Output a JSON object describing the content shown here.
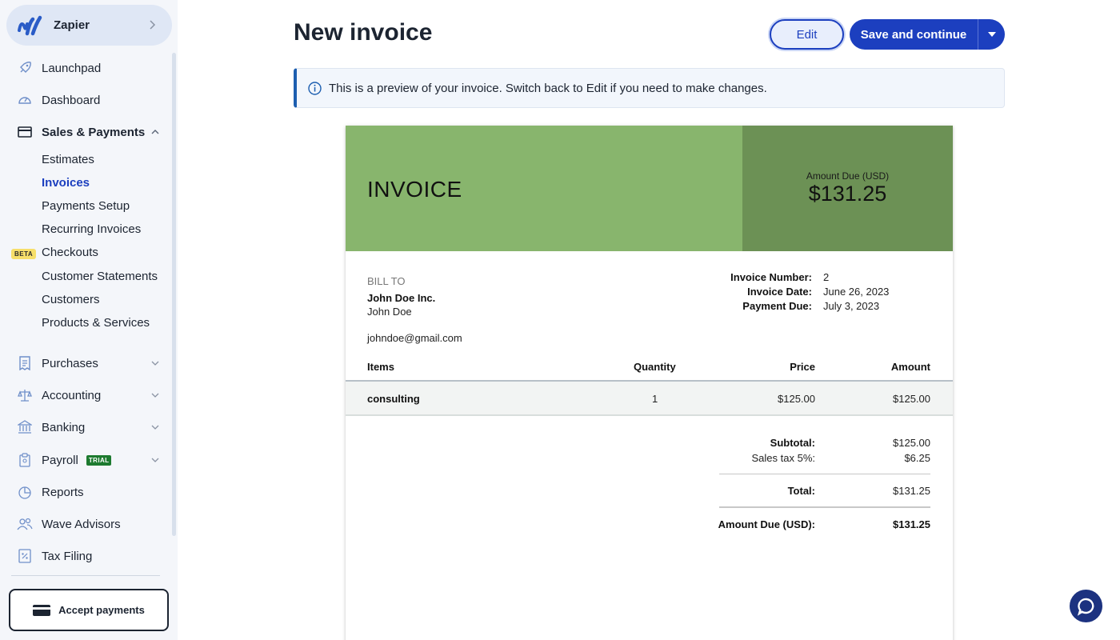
{
  "business": {
    "name": "Zapier"
  },
  "nav": {
    "launchpad": "Launchpad",
    "dashboard": "Dashboard",
    "sales_payments": "Sales & Payments",
    "sub_items": [
      "Estimates",
      "Invoices",
      "Payments Setup",
      "Recurring Invoices",
      "Checkouts",
      "Customer Statements",
      "Customers",
      "Products & Services"
    ],
    "beta_badge": "BETA",
    "purchases": "Purchases",
    "accounting": "Accounting",
    "banking": "Banking",
    "payroll": "Payroll",
    "trial_badge": "TRIAL",
    "reports": "Reports",
    "wave_advisors": "Wave Advisors",
    "tax_filing": "Tax Filing",
    "accept_payments": "Accept payments"
  },
  "header": {
    "title": "New invoice",
    "edit_label": "Edit",
    "save_label": "Save and continue"
  },
  "notice": {
    "text": "This is a preview of your invoice. Switch back to Edit if you need to make changes."
  },
  "invoice": {
    "title": "INVOICE",
    "amount_due_label": "Amount Due (USD)",
    "amount_due_value": "$131.25",
    "bill_to_label": "BILL TO",
    "customer_name": "John Doe Inc.",
    "customer_contact": "John Doe",
    "customer_email": "johndoe@gmail.com",
    "meta": [
      {
        "key": "Invoice Number:",
        "value": "2"
      },
      {
        "key": "Invoice Date:",
        "value": "June 26, 2023"
      },
      {
        "key": "Payment Due:",
        "value": "July 3, 2023"
      }
    ],
    "columns": [
      "Items",
      "Quantity",
      "Price",
      "Amount"
    ],
    "rows": [
      {
        "item": "consulting",
        "quantity": "1",
        "price": "$125.00",
        "amount": "$125.00"
      }
    ],
    "subtotal_label": "Subtotal:",
    "subtotal_value": "$125.00",
    "tax_label": "Sales tax 5%:",
    "tax_value": "$6.25",
    "total_label": "Total:",
    "total_value": "$131.25",
    "due_label": "Amount Due (USD):",
    "due_value": "$131.25",
    "header_color": "#88b56d",
    "header_accent_color": "#6c9155"
  },
  "colors": {
    "brand": "#1c3fbf",
    "active_nav": "#1c3fbf"
  }
}
